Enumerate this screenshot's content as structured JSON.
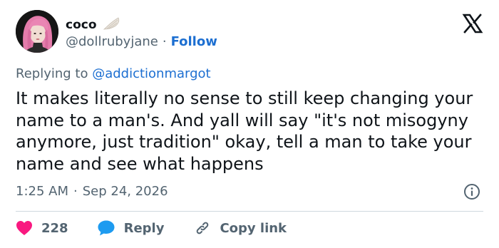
{
  "user": {
    "display_name": "coco",
    "handle": "@dollrubyjane",
    "follow_label": "Follow",
    "separator": "·"
  },
  "reply_context": {
    "prefix": "Replying to ",
    "mention": "@addictionmargot"
  },
  "tweet": {
    "text": "It makes literally no sense to still keep changing your name to a man's. And yall will say \"it's not misogyny anymore, just tradition\" okay, tell a man to take your name and see what happens",
    "time": "1:25 AM",
    "date": "Sep 24, 2026",
    "separator": "·"
  },
  "actions": {
    "like_count": "228",
    "reply_label": "Reply",
    "copy_label": "Copy link"
  },
  "colors": {
    "like": "#f91880",
    "reply": "#1d9bf0",
    "link": "#1d6fd1",
    "muted": "#536471",
    "text": "#0f1419",
    "divider": "#cfd9de"
  },
  "icons": [
    "avatar",
    "wings-icon",
    "x-logo-icon",
    "info-icon",
    "heart-icon",
    "reply-bubble-icon",
    "link-icon"
  ]
}
